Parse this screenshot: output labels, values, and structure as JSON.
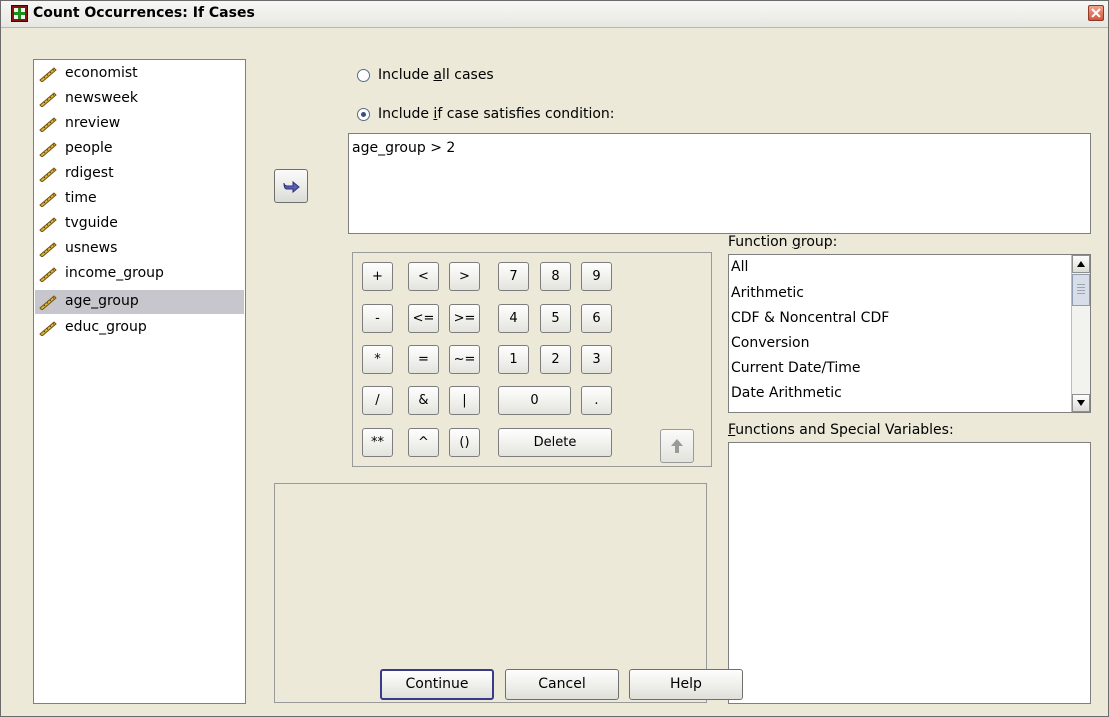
{
  "window": {
    "title": "Count Occurrences: If Cases"
  },
  "variables": [
    {
      "label": "economist",
      "icon": "scale-variable-icon"
    },
    {
      "label": "newsweek",
      "icon": "scale-variable-icon"
    },
    {
      "label": "nreview",
      "icon": "scale-variable-icon"
    },
    {
      "label": "people",
      "icon": "scale-variable-icon"
    },
    {
      "label": "rdigest",
      "icon": "scale-variable-icon"
    },
    {
      "label": "time",
      "icon": "scale-variable-icon"
    },
    {
      "label": "tvguide",
      "icon": "scale-variable-icon"
    },
    {
      "label": "usnews",
      "icon": "scale-variable-icon"
    },
    {
      "label": "income_group",
      "icon": "scale-variable-icon"
    },
    {
      "label": "age_group",
      "icon": "scale-variable-icon",
      "selected": true
    },
    {
      "label": "educ_group",
      "icon": "scale-variable-icon"
    }
  ],
  "options": {
    "all_cases": {
      "pre": "Include ",
      "mnemonic": "a",
      "post": "ll cases",
      "checked": false
    },
    "if_case": {
      "pre": "Include ",
      "mnemonic": "i",
      "post": "f case satisfies condition:",
      "checked": true
    }
  },
  "expression": "age_group > 2",
  "keypad": {
    "keys": [
      "+",
      "<",
      ">",
      "7",
      "8",
      "9",
      "-",
      "<=",
      ">=",
      "4",
      "5",
      "6",
      "*",
      "=",
      "~=",
      "1",
      "2",
      "3",
      "/",
      "&",
      "|",
      "0",
      ".",
      "**",
      "^",
      "()",
      "Delete"
    ]
  },
  "function_group": {
    "label_pre": "Function ",
    "label_mnemonic": "g",
    "label_post": "roup:",
    "items": [
      "All",
      "Arithmetic",
      "CDF & Noncentral CDF",
      "Conversion",
      "Current Date/Time",
      "Date Arithmetic"
    ]
  },
  "functions": {
    "label_mnemonic": "F",
    "label_post": "unctions and Special Variables:"
  },
  "buttons": {
    "continue": "Continue",
    "cancel": "Cancel",
    "help": "Help"
  },
  "colors": {
    "dialog_bg": "#ece9d8",
    "selection": "#c6c6cc",
    "arrow_accent": "#5a5fb8"
  }
}
